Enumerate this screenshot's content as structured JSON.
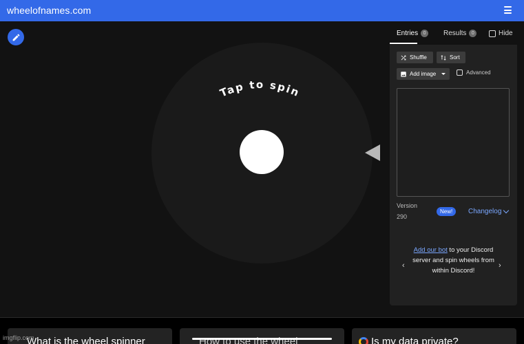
{
  "header": {
    "site_title": "wheelofnames.com",
    "menu_icon": "hamburger-menu-icon",
    "bar_color": "#3369e8"
  },
  "wheel": {
    "prompt": "Tap to spin",
    "edit_icon": "pencil-icon",
    "pointer_icon": "triangle-pointer-icon"
  },
  "tabs": {
    "entries_label": "Entries",
    "entries_count": "0",
    "results_label": "Results",
    "results_count": "0",
    "hide_label": "Hide"
  },
  "entries_panel": {
    "shuffle_label": "Shuffle",
    "sort_label": "Sort",
    "add_image_label": "Add image",
    "advanced_label": "Advanced",
    "textarea_value": ""
  },
  "version": {
    "label": "Version",
    "number": "290",
    "badge": "New!",
    "changelog_label": "Changelog"
  },
  "discord": {
    "link_text": "Add our bot",
    "text": " to your Discord server and spin wheels from within Discord!",
    "prev": "‹",
    "next": "›"
  },
  "faq_cards": [
    {
      "title": "What is the wheel spinner"
    },
    {
      "title": "How to use the wheel"
    },
    {
      "title": "Is my data private?"
    }
  ],
  "watermark": "imgflip.com"
}
